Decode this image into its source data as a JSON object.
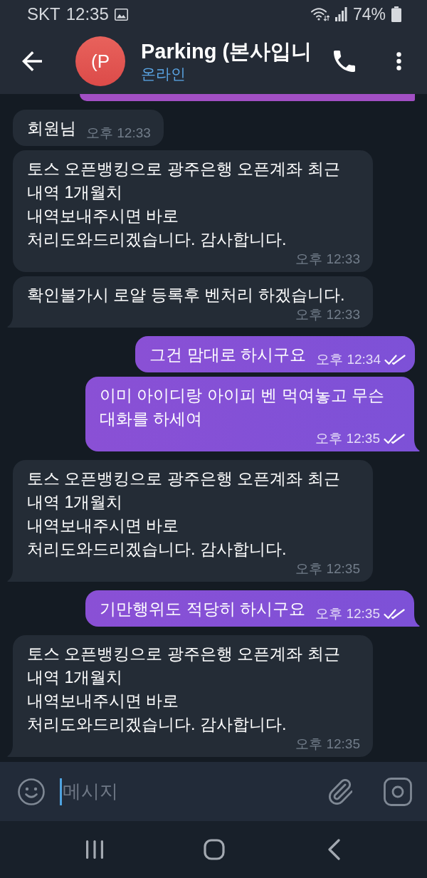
{
  "status_bar": {
    "carrier": "SKT",
    "time": "12:35",
    "battery": "74%"
  },
  "header": {
    "avatar_initials": "(P",
    "title": "Parking (본사입니",
    "status": "온라인"
  },
  "messages": [
    {
      "kind": "clipped"
    },
    {
      "kind": "incoming",
      "text": "회원님",
      "time": "오후 12:33",
      "tail": false
    },
    {
      "kind": "incoming",
      "text": "토스 오픈뱅킹으로 광주은행 오픈계좌 최근\n내역 1개월치\n내역보내주시면 바로\n처리도와드리겠습니다. 감사합니다.",
      "time": "오후 12:33",
      "tail": false
    },
    {
      "kind": "incoming",
      "text": "확인불가시 로얄 등록후 벤처리 하겠습니다.",
      "time": "오후 12:33",
      "tail": true
    },
    {
      "kind": "outgoing",
      "text": "그건 맘대로 하시구요",
      "time": "오후 12:34",
      "read": true,
      "tail": false
    },
    {
      "kind": "outgoing",
      "text": "이미 아이디랑 아이피 벤 먹여놓고 무슨 대화를 하세여",
      "time": "오후 12:35",
      "read": true,
      "tail": true
    },
    {
      "kind": "incoming",
      "text": "토스 오픈뱅킹으로 광주은행 오픈계좌 최근\n내역 1개월치\n내역보내주시면 바로\n처리도와드리겠습니다. 감사합니다.",
      "time": "오후 12:35",
      "tail": true
    },
    {
      "kind": "outgoing",
      "text": "기만행위도 적당히 하시구요",
      "time": "오후 12:35",
      "read": true,
      "tail": true
    },
    {
      "kind": "incoming",
      "text": "토스 오픈뱅킹으로 광주은행 오픈계좌 최근\n내역 1개월치\n내역보내주시면 바로\n처리도와드리겠습니다. 감사합니다.",
      "time": "오후 12:35",
      "tail": true
    }
  ],
  "composer": {
    "placeholder": "메시지"
  }
}
